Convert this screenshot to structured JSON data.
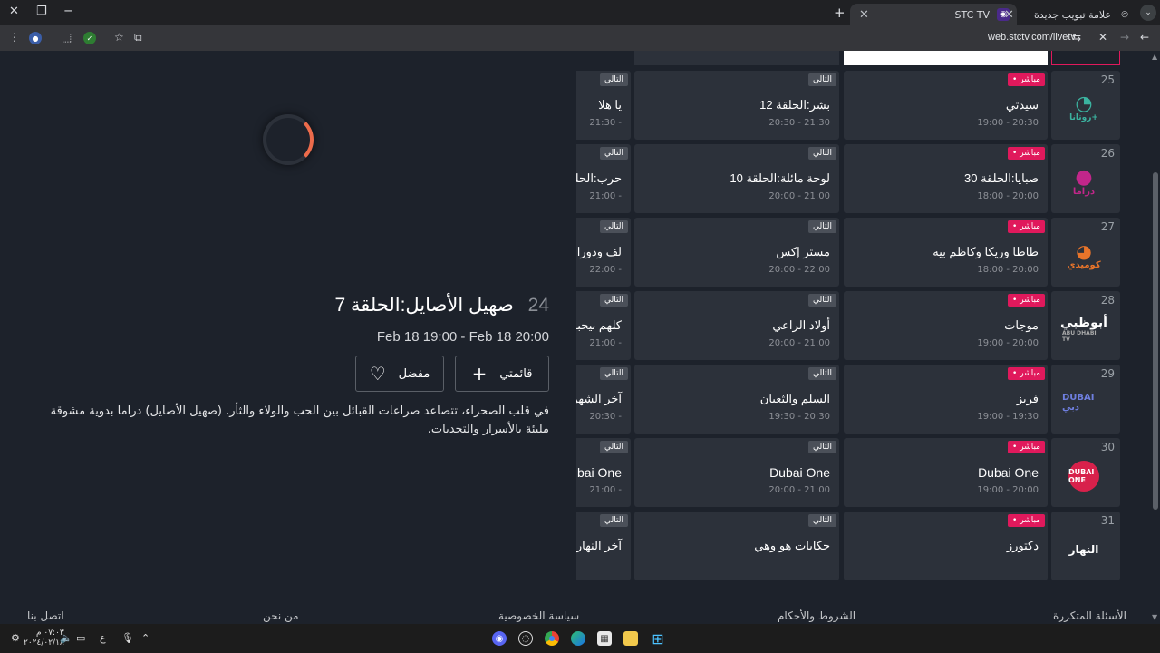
{
  "browser": {
    "tabs": [
      {
        "title": "STC TV",
        "active": true
      },
      {
        "title": "علامة تبويب جديدة",
        "active": false
      }
    ],
    "url": "web.stctv.com/livetv"
  },
  "detail": {
    "channel_number": "24",
    "title": "صهيل الأصايل:الحلقة 7",
    "time_range": "Feb 18 19:00 - Feb 18 20:00",
    "my_list_label": "قائمتي",
    "favorite_label": "مفضل",
    "description": "في قلب الصحراء، تتصاعد صراعات القبائل بين الحب والولاء والثأر. (صهيل الأصايل) دراما بدوية مشوقة مليئة بالأسرار والتحديات."
  },
  "epg": {
    "live_tag": "• مباشر",
    "next_tag": "التالي",
    "rows": [
      {
        "number": "25",
        "logo": "روتانا+",
        "logo_color": "#3bb3a0",
        "live": {
          "title": "سيدتي",
          "time": "19:00 - 20:30"
        },
        "next": {
          "title": "بشر:الحلقة 12",
          "time": "20:30 - 21:30"
        },
        "next2": {
          "title": "يا هلا",
          "time": "21:30 -"
        }
      },
      {
        "number": "26",
        "logo": "دراما",
        "logo_color": "#c2268a",
        "live": {
          "title": "صبايا:الحلقة 30",
          "time": "18:00 - 20:00"
        },
        "next": {
          "title": "لوحة مائلة:الحلقة 10",
          "time": "20:00 - 21:00"
        },
        "next2": {
          "title": "حرب:الحلقة",
          "time": "21:00 -"
        }
      },
      {
        "number": "27",
        "logo": "كوميدي",
        "logo_color": "#e8742a",
        "live": {
          "title": "طاطا وريكا وكاظم بيه",
          "time": "18:00 - 20:00"
        },
        "next": {
          "title": "مستر إكس",
          "time": "20:00 - 22:00"
        },
        "next2": {
          "title": "لف ودورا",
          "time": "22:00 -"
        }
      },
      {
        "number": "28",
        "logo": "أبوظبي",
        "logo_color": "#ffffff",
        "live": {
          "title": "موجات",
          "time": "19:00 - 20:00"
        },
        "next": {
          "title": "أولاد الراعي",
          "time": "20:00 - 21:00"
        },
        "next2": {
          "title": "كلهم بيحبو",
          "time": "21:00 -"
        }
      },
      {
        "number": "29",
        "logo": "DUBAI دبي",
        "logo_color": "#6f7fe0",
        "live": {
          "title": "فريز",
          "time": "19:00 - 19:30"
        },
        "next": {
          "title": "السلم والثعبان",
          "time": "19:30 - 20:30"
        },
        "next2": {
          "title": "آخر الشهر",
          "time": "20:30 -"
        }
      },
      {
        "number": "30",
        "logo": "DUBAI ONE",
        "logo_color": "#d8214b",
        "live": {
          "title": "Dubai One",
          "time": "19:00 - 20:00"
        },
        "next": {
          "title": "Dubai One",
          "time": "20:00 - 21:00"
        },
        "next2": {
          "title": "Dubai One",
          "time": "21:00 -"
        }
      },
      {
        "number": "31",
        "logo": "النهار",
        "logo_color": "#ffffff",
        "live": {
          "title": "دكتورز",
          "time": ""
        },
        "next": {
          "title": "حكايات هو وهي",
          "time": ""
        },
        "next2": {
          "title": "آخر النهار",
          "time": ""
        }
      }
    ]
  },
  "footer": {
    "faq": "الأسئلة المتكررة",
    "terms": "الشروط والأحكام",
    "privacy": "سياسة الخصوصية",
    "about": "من نحن",
    "contact": "اتصل بنا"
  },
  "taskbar": {
    "time": "٠٧:٠٣ م",
    "date": "٢٠٢٤/٠٢/١٨",
    "lang": "ع"
  },
  "colors": {
    "live_badge": "#e0195c",
    "background": "#1d222b",
    "cell": "#2c313a",
    "spinner": "#ec6b4b"
  }
}
